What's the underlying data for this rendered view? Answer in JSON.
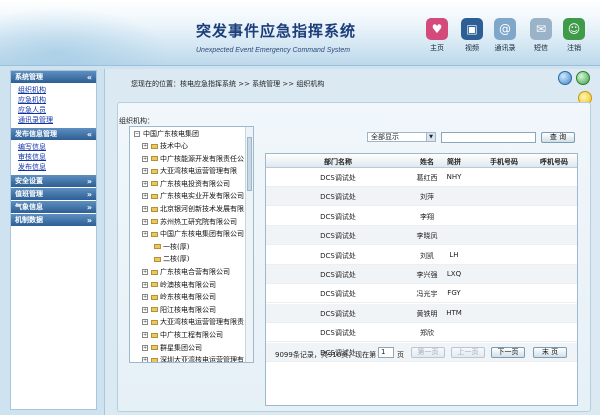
{
  "header": {
    "title_cn": "突发事件应急指挥系统",
    "title_en": "Unexpected Event Emergency Command System",
    "nav": [
      {
        "label": "主页",
        "icon": "home-icon",
        "color": "#d44a7a"
      },
      {
        "label": "视频",
        "icon": "video-icon",
        "color": "#2b5f95"
      },
      {
        "label": "通讯录",
        "icon": "contacts-icon",
        "color": "#7fa7c9"
      },
      {
        "label": "短信",
        "icon": "sms-icon",
        "color": "#9ab3c8"
      },
      {
        "label": "注销",
        "icon": "logout-icon",
        "color": "#3f9a4a"
      }
    ]
  },
  "sidebar": {
    "sections": [
      {
        "title": "系统管理",
        "chevron": "«",
        "items": [
          "组织机构",
          "应急机构",
          "应急人员",
          "通讯录管理"
        ]
      },
      {
        "title": "发布信息管理",
        "chevron": "«",
        "items": [
          "编写信息",
          "审核信息",
          "发布信息"
        ]
      },
      {
        "title": "安全设置",
        "chevron": "»",
        "items": []
      },
      {
        "title": "值班管理",
        "chevron": "»",
        "items": []
      },
      {
        "title": "气象信息",
        "chevron": "»",
        "items": []
      },
      {
        "title": "机制数据",
        "chevron": "»",
        "items": []
      }
    ]
  },
  "breadcrumb": "您现在的位置：核电应急指挥系统 >> 系统管理 >> 组织机构",
  "org_label": "组织机构：",
  "tree": {
    "root": "中国广东核电集团",
    "items": [
      "技术中心",
      "中广核能源开发有限责任公",
      "大亚湾核电运营管理有限",
      "广东核电投资有限公司",
      "广东核电实业开发有限公司",
      "北京银河创新技术发展有限",
      "苏州热工研究院有限公司",
      "中国广东核电集团有限公司",
      "一核(厚)",
      "二核(厚)",
      "广东核电合营有限公司",
      "岭澳核电有限公司",
      "岭东核电有限公司",
      "阳江核电有限公司",
      "大亚湾核电运营管理有限责",
      "中广核工程有限公司",
      "群星集团公司",
      "深圳大亚湾核电运营管理有"
    ]
  },
  "search": {
    "filter_value": "全部显示",
    "query_value": "",
    "button_label": "查  询"
  },
  "table": {
    "columns": [
      "部门名称",
      "姓名",
      "简拼",
      "手机号码",
      "呼机号码"
    ],
    "rows": [
      {
        "dept": "DCS调试处",
        "name": "葛红西",
        "abbr": "NHY"
      },
      {
        "dept": "DCS调试处",
        "name": "刘萍",
        "abbr": ""
      },
      {
        "dept": "DCS调试处",
        "name": "李翔",
        "abbr": ""
      },
      {
        "dept": "DCS调试处",
        "name": "李晓凤",
        "abbr": ""
      },
      {
        "dept": "DCS调试处",
        "name": "刘凯",
        "abbr": "LH"
      },
      {
        "dept": "DCS调试处",
        "name": "李兴强",
        "abbr": "LXQ"
      },
      {
        "dept": "DCS调试处",
        "name": "冯光宇",
        "abbr": "FGY"
      },
      {
        "dept": "DCS调试处",
        "name": "黄铁明",
        "abbr": "HTM"
      },
      {
        "dept": "DCS调试处",
        "name": "郑欣",
        "abbr": ""
      },
      {
        "dept": "DCS调试处",
        "name": "余哲",
        "abbr": ""
      }
    ]
  },
  "pager": {
    "summary": "9099条记录，共910页，现在第",
    "current": "1",
    "suffix": "页",
    "buttons": [
      "第一页",
      "上一页",
      "下一页",
      "末 页"
    ]
  }
}
